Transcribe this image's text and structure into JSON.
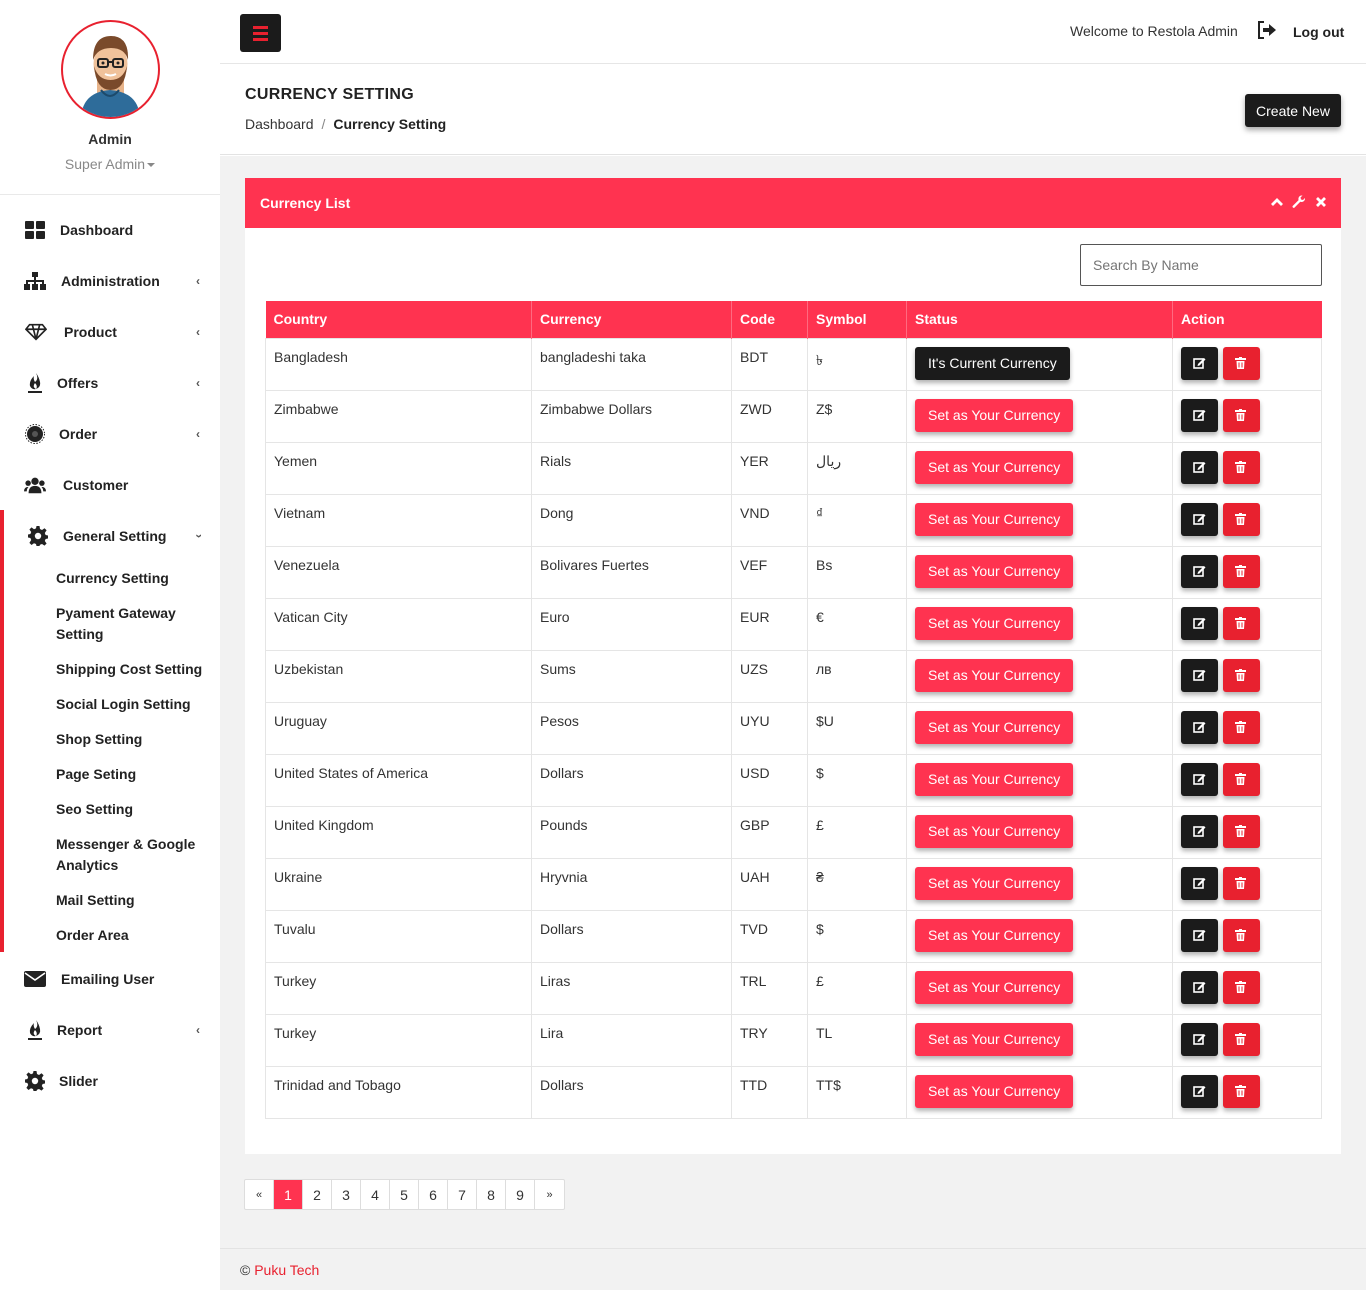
{
  "user": {
    "name": "Admin",
    "role": "Super Admin"
  },
  "topbar": {
    "welcome": "Welcome to Restola Admin",
    "logout_label": "Log out"
  },
  "sidebar": {
    "items": [
      {
        "label": "Dashboard",
        "icon": "dashboard-icon"
      },
      {
        "label": "Administration",
        "icon": "sitemap-icon"
      },
      {
        "label": "Product",
        "icon": "diamond-icon"
      },
      {
        "label": "Offers",
        "icon": "fire-icon"
      },
      {
        "label": "Order",
        "icon": "star-burst-icon"
      },
      {
        "label": "Customer",
        "icon": "users-icon"
      },
      {
        "label": "General Setting",
        "icon": "gear-icon"
      },
      {
        "label": "Emailing User",
        "icon": "envelope-icon"
      },
      {
        "label": "Report",
        "icon": "fire-icon"
      },
      {
        "label": "Slider",
        "icon": "gear-icon"
      }
    ],
    "submenu": [
      "Currency Setting",
      "Pyament Gateway Setting",
      "Shipping Cost Setting",
      "Social Login Setting",
      "Shop Setting",
      "Page Seting",
      "Seo Setting",
      "Messenger & Google Analytics",
      "Mail Setting",
      "Order Area"
    ]
  },
  "header": {
    "title": "CURRENCY SETTING",
    "breadcrumb": [
      "Dashboard",
      "Currency Setting"
    ],
    "breadcrumb_sep": "/",
    "create_label": "Create New"
  },
  "panel": {
    "title": "Currency List",
    "search_placeholder": "Search By Name"
  },
  "table": {
    "columns": [
      "Country",
      "Currency",
      "Code",
      "Symbol",
      "Status",
      "Action"
    ],
    "current_label": "It's Current Currency",
    "set_label": "Set as Your Currency",
    "rows": [
      {
        "country": "Bangladesh",
        "currency": "bangladeshi taka",
        "code": "BDT",
        "symbol": "৳",
        "current": true
      },
      {
        "country": "Zimbabwe",
        "currency": "Zimbabwe Dollars",
        "code": "ZWD",
        "symbol": "Z$",
        "current": false
      },
      {
        "country": "Yemen",
        "currency": "Rials",
        "code": "YER",
        "symbol": "ريال",
        "current": false
      },
      {
        "country": "Vietnam",
        "currency": "Dong",
        "code": "VND",
        "symbol": "₫",
        "current": false
      },
      {
        "country": "Venezuela",
        "currency": "Bolivares Fuertes",
        "code": "VEF",
        "symbol": "Bs",
        "current": false
      },
      {
        "country": "Vatican City",
        "currency": "Euro",
        "code": "EUR",
        "symbol": "€",
        "current": false
      },
      {
        "country": "Uzbekistan",
        "currency": "Sums",
        "code": "UZS",
        "symbol": "лв",
        "current": false
      },
      {
        "country": "Uruguay",
        "currency": "Pesos",
        "code": "UYU",
        "symbol": "$U",
        "current": false
      },
      {
        "country": "United States of America",
        "currency": "Dollars",
        "code": "USD",
        "symbol": "$",
        "current": false
      },
      {
        "country": "United Kingdom",
        "currency": "Pounds",
        "code": "GBP",
        "symbol": "£",
        "current": false
      },
      {
        "country": "Ukraine",
        "currency": "Hryvnia",
        "code": "UAH",
        "symbol": "₴",
        "current": false
      },
      {
        "country": "Tuvalu",
        "currency": "Dollars",
        "code": "TVD",
        "symbol": "$",
        "current": false
      },
      {
        "country": "Turkey",
        "currency": "Liras",
        "code": "TRL",
        "symbol": "£",
        "current": false
      },
      {
        "country": "Turkey",
        "currency": "Lira",
        "code": "TRY",
        "symbol": "TL",
        "current": false
      },
      {
        "country": "Trinidad and Tobago",
        "currency": "Dollars",
        "code": "TTD",
        "symbol": "TT$",
        "current": false
      }
    ]
  },
  "pagination": {
    "prev": "«",
    "next": "»",
    "pages": [
      "1",
      "2",
      "3",
      "4",
      "5",
      "6",
      "7",
      "8",
      "9"
    ],
    "current": "1"
  },
  "footer": {
    "copyright": "©",
    "brand": "Puku Tech"
  },
  "colors": {
    "accent": "#ff3350",
    "dark": "#1b1b1b",
    "red": "#e8212f"
  }
}
